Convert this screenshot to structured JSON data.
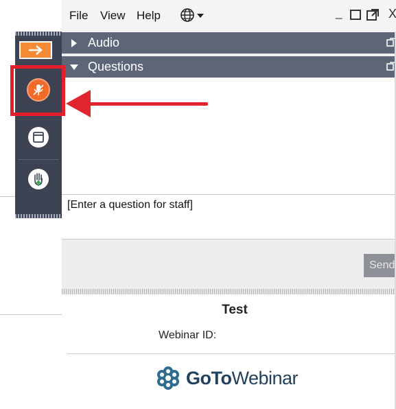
{
  "menu": {
    "items": [
      "File",
      "View",
      "Help"
    ],
    "language_icon": "globe-icon"
  },
  "window_controls": {
    "close_glyph": "X"
  },
  "panes": {
    "audio": {
      "label": "Audio",
      "expanded": false
    },
    "questions": {
      "label": "Questions",
      "expanded": true
    }
  },
  "question_input": {
    "placeholder": "[Enter a question for staff]"
  },
  "send_button": {
    "label": "Send"
  },
  "webinar": {
    "title": "Test",
    "id_label": "Webinar ID:",
    "id_value": ""
  },
  "brand": {
    "name_bold": "GoTo",
    "name_regular": "Webinar"
  },
  "sidebar": {
    "buttons": [
      "collapse-arrow-icon",
      "microphone-icon",
      "window-icon",
      "raise-hand-icon"
    ]
  },
  "colors": {
    "sidebar": "#3d4352",
    "pane_header": "#5d6579",
    "accent_orange": "#f26a2a",
    "annotation_red": "#e0252f",
    "brand_blue": "#23415c"
  }
}
